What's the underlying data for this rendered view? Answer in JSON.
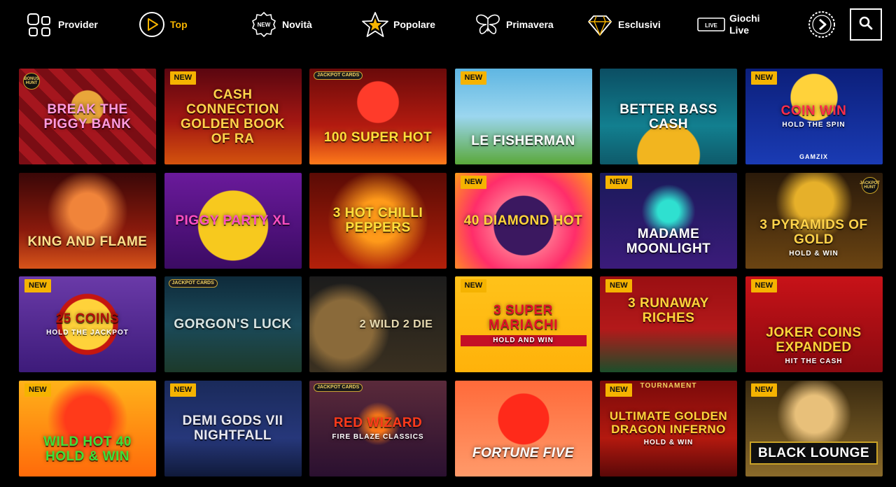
{
  "nav": {
    "items": [
      {
        "label": "Provider",
        "icon": "provider-grid-icon"
      },
      {
        "label": "Top",
        "icon": "play-circle-icon",
        "active": true
      },
      {
        "label": "Novità",
        "icon": "new-badge-icon",
        "icon_text": "NEW"
      },
      {
        "label": "Popolare",
        "icon": "star-icon"
      },
      {
        "label": "Primavera",
        "icon": "butterfly-icon"
      },
      {
        "label": "Esclusivi",
        "icon": "diamond-icon"
      },
      {
        "label": "Giochi Live",
        "icon": "live-icon",
        "icon_text": "LIVE"
      }
    ],
    "more_icon": "chevron-right-circle-icon",
    "search_icon": "search-icon",
    "accent_color": "#f5b301"
  },
  "badges": {
    "new": "NEW"
  },
  "games": [
    {
      "title": "Break the Piggy Bank",
      "new": false,
      "provider_badge": "BONUS HUNT"
    },
    {
      "title": "Cash Connection Golden Book of Ra",
      "new": true
    },
    {
      "title": "100 Super Hot",
      "new": false,
      "jackpot_badge": "JACKPOT CARDS"
    },
    {
      "title": "Le Fisherman",
      "new": true
    },
    {
      "title": "Better Bass Cash",
      "new": false
    },
    {
      "title": "Coin Win",
      "subtitle": "HOLD THE SPIN",
      "brand": "GAMZIX",
      "new": true
    },
    {
      "title": "King and Flame",
      "new": false
    },
    {
      "title": "Piggy Party XL",
      "new": false
    },
    {
      "title": "3 Hot Chilli Peppers",
      "new": false
    },
    {
      "title": "40 Diamond Hot",
      "new": true
    },
    {
      "title": "Madame Moonlight",
      "new": true
    },
    {
      "title": "3 Pyramids of Gold",
      "subtitle": "HOLD & WIN",
      "new": false,
      "provider_badge": "JACKPOT HUNT"
    },
    {
      "title": "25 Coins",
      "subtitle": "HOLD THE JACKPOT",
      "new": true
    },
    {
      "title": "Gorgon's Luck",
      "new": false,
      "jackpot_badge": "JACKPOT CARDS"
    },
    {
      "title": "2 Wild 2 Die",
      "new": false
    },
    {
      "title": "3 Super Mariachi",
      "subtitle": "HOLD AND WIN",
      "new": true
    },
    {
      "title": "3 Runaway Riches",
      "new": true
    },
    {
      "title": "Joker Coins Expanded",
      "subtitle": "HIT THE CASH",
      "new": true
    },
    {
      "title": "Wild Hot 40 Hold & Win",
      "new": true
    },
    {
      "title": "Demi Gods VII Nightfall",
      "new": true
    },
    {
      "title": "Red Wizard",
      "subtitle": "FIRE BLAZE CLASSICS",
      "new": false,
      "jackpot_badge": "JACKPOT CARDS"
    },
    {
      "title": "Fortune Five",
      "new": false
    },
    {
      "title": "Ultimate Golden Dragon Inferno",
      "subtitle": "HOLD & WIN",
      "tournament": "TOURNAMENT",
      "new": true
    },
    {
      "title": "Black Lounge",
      "new": true
    }
  ]
}
